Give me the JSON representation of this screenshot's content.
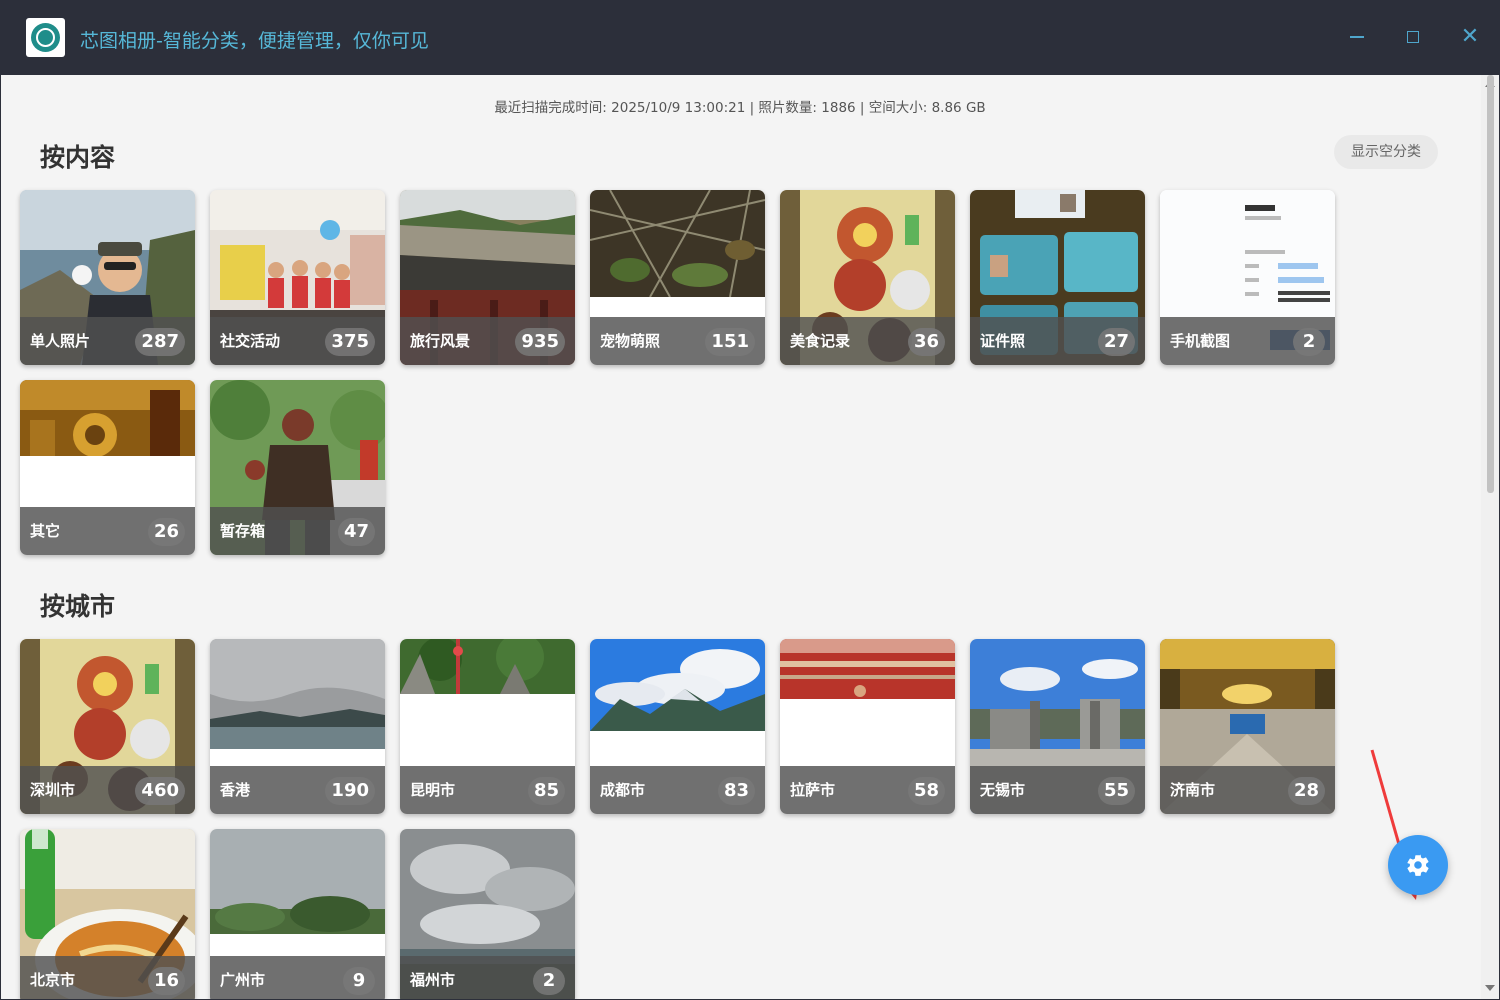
{
  "window": {
    "title": "芯图相册-智能分类，便捷管理，仅你可见",
    "close_glyph": "✕"
  },
  "scan_info": "最近扫描完成时间: 2025/10/9 13:00:21 | 照片数量: 1886 | 空间大小: 8.86 GB",
  "content_section": {
    "title": "按内容",
    "show_empty_label": "显示空分类",
    "items": [
      {
        "name": "单人照片",
        "count": "287",
        "icon": "person-photo"
      },
      {
        "name": "社交活动",
        "count": "375",
        "icon": "group-photo"
      },
      {
        "name": "旅行风景",
        "count": "935",
        "icon": "landscape-photo"
      },
      {
        "name": "宠物萌照",
        "count": "151",
        "icon": "pet-photo"
      },
      {
        "name": "美食记录",
        "count": "36",
        "icon": "food-photo"
      },
      {
        "name": "证件照",
        "count": "27",
        "icon": "id-card-photo"
      },
      {
        "name": "手机截图",
        "count": "2",
        "icon": "screenshot-photo"
      },
      {
        "name": "其它",
        "count": "26",
        "icon": "other-photo"
      },
      {
        "name": "暂存箱",
        "count": "47",
        "icon": "staging-photo"
      }
    ]
  },
  "city_section": {
    "title": "按城市",
    "items": [
      {
        "name": "深圳市",
        "count": "460"
      },
      {
        "name": "香港",
        "count": "190"
      },
      {
        "name": "昆明市",
        "count": "85"
      },
      {
        "name": "成都市",
        "count": "83"
      },
      {
        "name": "拉萨市",
        "count": "58"
      },
      {
        "name": "无锡市",
        "count": "55"
      },
      {
        "name": "济南市",
        "count": "28"
      },
      {
        "name": "北京市",
        "count": "16"
      },
      {
        "name": "广州市",
        "count": "9"
      },
      {
        "name": "福州市",
        "count": "2"
      }
    ]
  },
  "settings": {
    "icon": "gear-icon"
  },
  "colors": {
    "accent": "#3a9af2",
    "titlebar": "#2c2f3a",
    "title_text": "#56b8d8",
    "annotation": "#ef3b3b"
  }
}
